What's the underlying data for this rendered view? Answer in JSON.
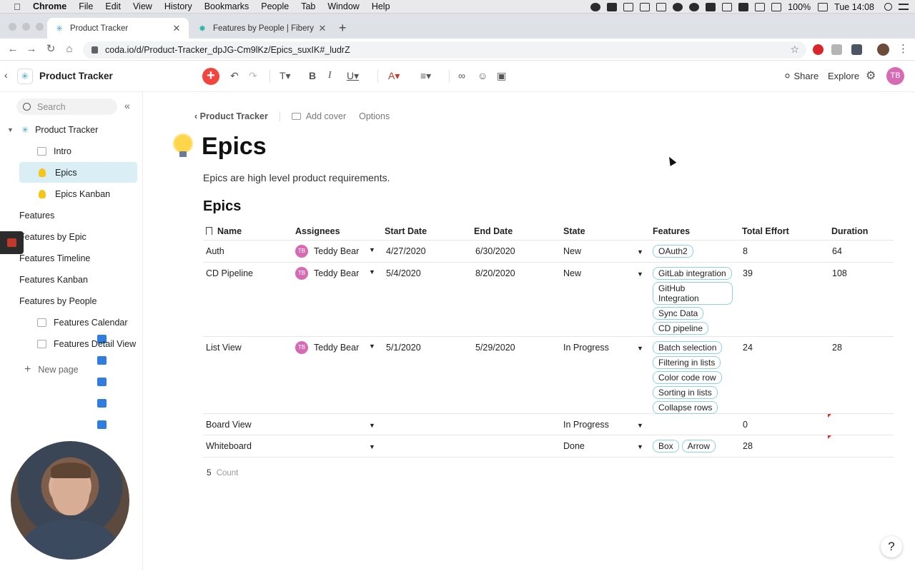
{
  "menubar": {
    "app": "Chrome",
    "items": [
      "File",
      "Edit",
      "View",
      "History",
      "Bookmarks",
      "People",
      "Tab",
      "Window",
      "Help"
    ],
    "battery": "100%",
    "clock": "Tue 14:08"
  },
  "browser": {
    "tabs": [
      {
        "title": "Product Tracker",
        "active": true
      },
      {
        "title": "Features by People | Fibery",
        "active": false
      }
    ],
    "url": "coda.io/d/Product-Tracker_dpJG-Cm9lKz/Epics_suxIK#_ludrZ"
  },
  "doc": {
    "title": "Product Tracker",
    "share_label": "Share",
    "explore_label": "Explore",
    "user_initials": "TB"
  },
  "sidebar": {
    "search_placeholder": "Search",
    "root": "Product Tracker",
    "items": [
      {
        "label": "Intro",
        "icon": "doc-icon"
      },
      {
        "label": "Epics",
        "icon": "bulb-icon",
        "selected": true
      },
      {
        "label": "Epics Kanban",
        "icon": "bulb-icon"
      },
      {
        "label": "Features",
        "icon": "table-icon"
      },
      {
        "label": "Features by Epic",
        "icon": "table-icon"
      },
      {
        "label": "Features Timeline",
        "icon": "table-icon"
      },
      {
        "label": "Features Kanban",
        "icon": "table-icon"
      },
      {
        "label": "Features by People",
        "icon": "table-icon"
      },
      {
        "label": "Features Calendar",
        "icon": "doc-icon"
      },
      {
        "label": "Features Detail View",
        "icon": "doc-icon"
      }
    ],
    "new_page": "New page"
  },
  "page": {
    "breadcrumb": "Product Tracker",
    "add_cover": "Add cover",
    "options": "Options",
    "title": "Epics",
    "subtitle": "Epics are high level product requirements.",
    "section_title": "Epics"
  },
  "table": {
    "columns": [
      "Name",
      "Assignees",
      "Start Date",
      "End Date",
      "State",
      "Features",
      "Total Effort",
      "Duration"
    ],
    "rows": [
      {
        "name": "Auth",
        "assignee": "Teddy Bear",
        "initials": "TB",
        "start": "4/27/2020",
        "end": "6/30/2020",
        "state": "New",
        "features": [
          "OAuth2"
        ],
        "effort": "8",
        "duration": "64"
      },
      {
        "name": "CD Pipeline",
        "assignee": "Teddy Bear",
        "initials": "TB",
        "start": "5/4/2020",
        "end": "8/20/2020",
        "state": "New",
        "features": [
          "GitLab integration",
          "GitHub Integration",
          "Sync Data",
          "CD pipeline"
        ],
        "effort": "39",
        "duration": "108"
      },
      {
        "name": "List View",
        "assignee": "Teddy Bear",
        "initials": "TB",
        "start": "5/1/2020",
        "end": "5/29/2020",
        "state": "In Progress",
        "features": [
          "Batch selection",
          "Filtering in lists",
          "Color code row",
          "Sorting in lists",
          "Collapse rows"
        ],
        "effort": "24",
        "duration": "28"
      },
      {
        "name": "Board View",
        "assignee": "",
        "initials": "",
        "start": "",
        "end": "",
        "state": "In Progress",
        "features": [],
        "effort": "0",
        "duration": ""
      },
      {
        "name": "Whiteboard",
        "assignee": "",
        "initials": "",
        "start": "",
        "end": "",
        "state": "Done",
        "features": [
          "Box",
          "Arrow"
        ],
        "effort": "28",
        "duration": ""
      }
    ],
    "count_value": "5",
    "count_label": "Count"
  },
  "help_label": "?"
}
